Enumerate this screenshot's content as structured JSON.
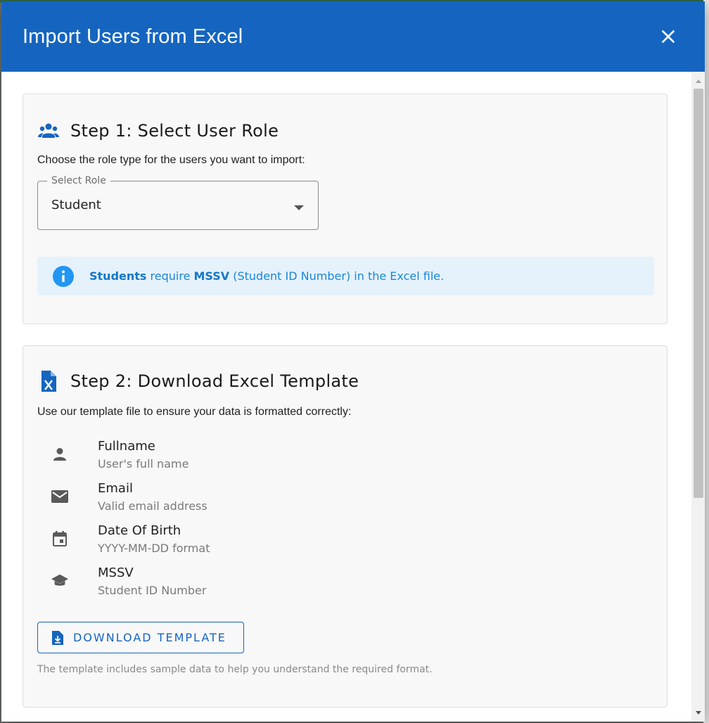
{
  "dialog": {
    "title": "Import Users from Excel",
    "close_icon": "close-icon"
  },
  "step1": {
    "title": "Step 1: Select User Role",
    "icon": "group-icon",
    "description": "Choose the role type for the users you want to import:",
    "select": {
      "label": "Select Role",
      "value": "Student"
    },
    "info": {
      "icon": "info-icon",
      "role_bold": "Students",
      "mid_text": " require ",
      "field_bold": "MSSV",
      "tail_text": " (Student ID Number) in the Excel file."
    }
  },
  "step2": {
    "title": "Step 2: Download Excel Template",
    "icon": "excel-file-icon",
    "description": "Use our template file to ensure your data is formatted correctly:",
    "fields": [
      {
        "icon": "person-icon",
        "name": "Fullname",
        "desc": "User's full name"
      },
      {
        "icon": "email-icon",
        "name": "Email",
        "desc": "Valid email address"
      },
      {
        "icon": "calendar-icon",
        "name": "Date Of Birth",
        "desc": "YYYY-MM-DD format"
      },
      {
        "icon": "school-icon",
        "name": "MSSV",
        "desc": "Student ID Number"
      }
    ],
    "download_button": "DOWNLOAD TEMPLATE",
    "footnote": "The template includes sample data to help you understand the required format."
  },
  "colors": {
    "header": "#1565c0",
    "info_bg": "#e5f2fc",
    "info_text": "#1a86d9",
    "card_bg": "#f8f8f8"
  }
}
